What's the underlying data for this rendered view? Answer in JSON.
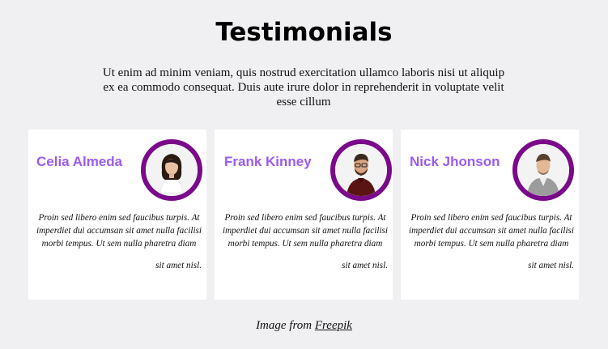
{
  "header": {
    "title": "Testimonials",
    "intro": "Ut enim ad minim veniam, quis nostrud exercitation ullamco laboris nisi ut aliquip ex ea commodo consequat. Duis aute irure dolor in reprehenderit in voluptate velit esse cillum"
  },
  "testimonials": [
    {
      "name": "Celia Almeda",
      "quote": "Proin sed libero enim sed faucibus turpis. At imperdiet dui accumsan sit amet nulla facilisi morbi tempus. Ut sem nulla pharetra diam",
      "quote_end": "sit amet nisl."
    },
    {
      "name": "Frank Kinney",
      "quote": "Proin sed libero enim sed faucibus turpis. At imperdiet dui accumsan sit amet nulla facilisi morbi tempus. Ut sem nulla pharetra diam",
      "quote_end": "sit amet nisl."
    },
    {
      "name": "Nick Jhonson",
      "quote": "Proin sed libero enim sed faucibus turpis. At imperdiet dui accumsan sit amet nulla facilisi morbi tempus. Ut sem nulla pharetra diam",
      "quote_end": "sit amet nisl."
    }
  ],
  "footer": {
    "credit_prefix": "Image from",
    "credit_link": "Freepik"
  },
  "colors": {
    "background": "#f0f0f3",
    "name": "#9a5cf0",
    "avatar_ring": "#7a0a8a"
  }
}
